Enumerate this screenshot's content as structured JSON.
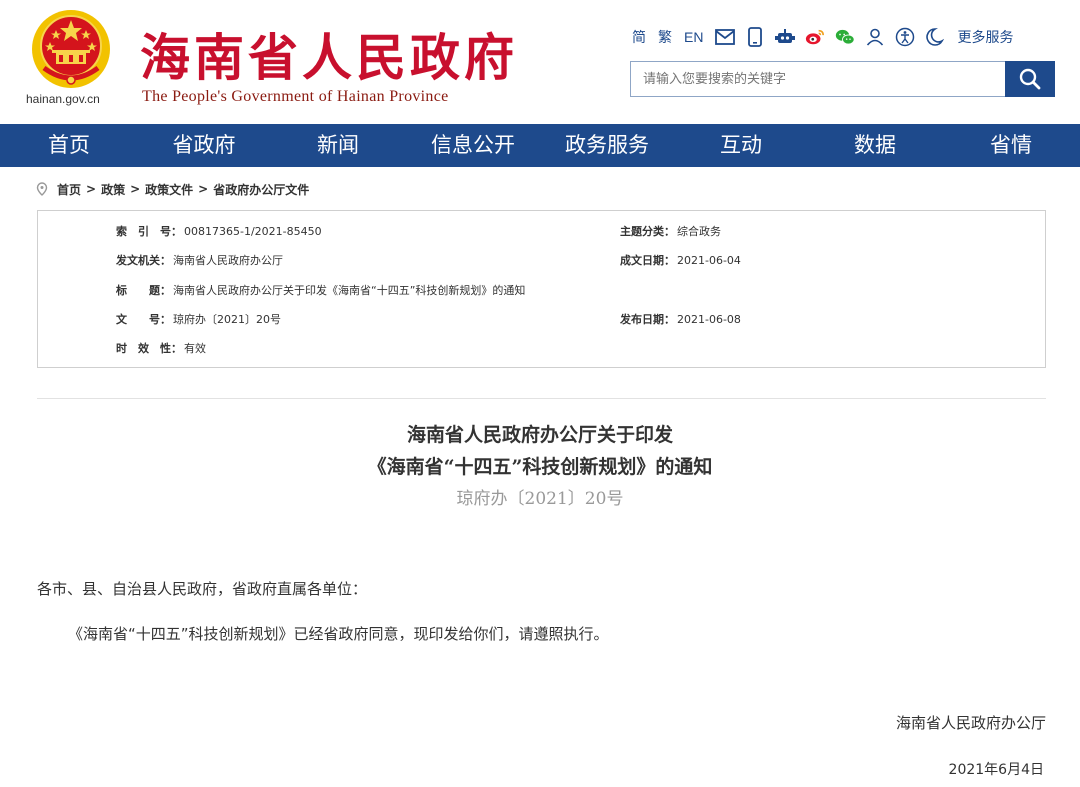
{
  "header": {
    "site_title": "海南省人民政府",
    "site_subtitle": "The People's Government of Hainan Province",
    "domain": "hainan.gov.cn",
    "toolbar": {
      "simplified": "简",
      "traditional": "繁",
      "english": "EN",
      "icons": [
        "mail-icon",
        "mobile-icon",
        "robot-icon",
        "weibo-icon",
        "wechat-icon",
        "user-icon",
        "accessibility-icon",
        "elderly-mode-icon"
      ],
      "more_services": "更多服务"
    },
    "search": {
      "placeholder": "请输入您要搜索的关键字"
    }
  },
  "nav": {
    "items": [
      "首页",
      "省政府",
      "新闻",
      "信息公开",
      "政务服务",
      "互动",
      "数据",
      "省情"
    ]
  },
  "breadcrumb": {
    "items": [
      "首页",
      "政策",
      "政策文件",
      "省政府办公厅文件"
    ],
    "separator": ">"
  },
  "meta": {
    "index_label": "索　引　号：",
    "index_value": "00817365-1/2021-85450",
    "category_label": "主题分类：",
    "category_value": "综合政务",
    "issuer_label": "发文机关：",
    "issuer_value": "海南省人民政府办公厅",
    "written_date_label": "成文日期：",
    "written_date_value": "2021-06-04",
    "title_label": "标　　题：",
    "title_value": "海南省人民政府办公厅关于印发《海南省“十四五”科技创新规划》的通知",
    "doc_no_label": "文　　号：",
    "doc_no_value": "琼府办〔2021〕20号",
    "publish_date_label": "发布日期：",
    "publish_date_value": "2021-06-08",
    "validity_label": "时　效　性：",
    "validity_value": "有效"
  },
  "document": {
    "title_line1": "海南省人民政府办公厅关于印发",
    "title_line2": "《海南省“十四五”科技创新规划》的通知",
    "number": "琼府办〔2021〕20号",
    "salutation": "各市、县、自治县人民政府，省政府直属各单位：",
    "body": "《海南省“十四五”科技创新规划》已经省政府同意，现印发给你们，请遵照执行。",
    "signature_org": "海南省人民政府办公厅",
    "signature_date": "2021年6月4日"
  },
  "colors": {
    "brand_blue": "#1e4a8c",
    "title_red": "#c8102e",
    "emblem_gold": "#f2c200"
  }
}
